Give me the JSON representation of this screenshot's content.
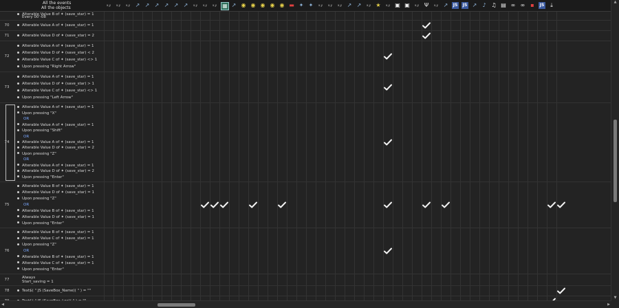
{
  "header": {
    "all_events": "All the events",
    "all_objects": "All the objects"
  },
  "columns": [
    {
      "kind": "tag",
      "glyph": "x,y"
    },
    {
      "kind": "tag",
      "glyph": "x,y"
    },
    {
      "kind": "tag",
      "glyph": "x,y"
    },
    {
      "kind": "plain",
      "glyph": "↗"
    },
    {
      "kind": "plain",
      "glyph": "↗"
    },
    {
      "kind": "plain",
      "glyph": "↗"
    },
    {
      "kind": "plain",
      "glyph": "↗"
    },
    {
      "kind": "plain",
      "glyph": "↗"
    },
    {
      "kind": "plain",
      "glyph": "↗"
    },
    {
      "kind": "tag",
      "glyph": "x,y"
    },
    {
      "kind": "tag",
      "glyph": "x,y"
    },
    {
      "kind": "tag",
      "glyph": "x,y"
    },
    {
      "kind": "box",
      "glyph": "▦"
    },
    {
      "kind": "plain",
      "glyph": "↗"
    },
    {
      "kind": "yellow",
      "glyph": "◉"
    },
    {
      "kind": "yellow",
      "glyph": "◉"
    },
    {
      "kind": "yellow",
      "glyph": "◉"
    },
    {
      "kind": "yellow",
      "glyph": "◉"
    },
    {
      "kind": "yellow",
      "glyph": "◉"
    },
    {
      "kind": "red",
      "glyph": "▬"
    },
    {
      "kind": "plain",
      "glyph": "✦"
    },
    {
      "kind": "plain",
      "glyph": "✦"
    },
    {
      "kind": "tag",
      "glyph": "x,y"
    },
    {
      "kind": "tag",
      "glyph": "x,y"
    },
    {
      "kind": "tag",
      "glyph": "x,y"
    },
    {
      "kind": "plain",
      "glyph": "↗"
    },
    {
      "kind": "plain",
      "glyph": "↗"
    },
    {
      "kind": "tag",
      "glyph": "x,y"
    },
    {
      "kind": "yellow",
      "glyph": "★"
    },
    {
      "kind": "tag",
      "glyph": "x,y"
    },
    {
      "kind": "white",
      "glyph": "▣"
    },
    {
      "kind": "white",
      "glyph": "▣"
    },
    {
      "kind": "tag",
      "glyph": "x,y"
    },
    {
      "kind": "white",
      "glyph": "Ψ"
    },
    {
      "kind": "tag",
      "glyph": "x,y"
    },
    {
      "kind": "plain",
      "glyph": "↗"
    },
    {
      "kind": "blue",
      "glyph": "JS"
    },
    {
      "kind": "blue",
      "glyph": "JS"
    },
    {
      "kind": "plain",
      "glyph": "↗"
    },
    {
      "kind": "plain",
      "glyph": "♪"
    },
    {
      "kind": "white",
      "glyph": "♫"
    },
    {
      "kind": "white",
      "glyph": "▤"
    },
    {
      "kind": "white",
      "glyph": "∞"
    },
    {
      "kind": "white",
      "glyph": "∞"
    },
    {
      "kind": "red",
      "glyph": "▪"
    },
    {
      "kind": "blue",
      "glyph": "JS"
    },
    {
      "kind": "white",
      "glyph": "⤓"
    }
  ],
  "rows": [
    {
      "num": "",
      "height": 12,
      "lines": [
        {
          "t": "Alterable Value B of ✦ (save_star) = 1",
          "bul": true
        },
        {
          "t": "Every 00'-08"
        }
      ],
      "checks": []
    },
    {
      "num": "70",
      "height": 14,
      "lines": [
        {
          "t": "Alterable Value A of ✦ (save_star) = 1",
          "bul": true
        }
      ],
      "checks": [
        33
      ]
    },
    {
      "num": "71",
      "height": 14,
      "lines": [
        {
          "t": "Alterable Value D of ✦ (save_star) = 2",
          "bul": true
        }
      ],
      "checks": [
        33
      ]
    },
    {
      "num": "72",
      "height": 44,
      "lines": [
        {
          "t": "Alterable Value A of ✦ (save_star) = 1",
          "bul": true
        },
        {
          "t": "Alterable Value D of ✦ (save_star) < 2",
          "bul": true
        },
        {
          "t": "Alterable Value C of ✦ (save_star) <> 1",
          "bul": true
        },
        {
          "t": "Upon pressing \"Right Arrow\"",
          "bul": true
        }
      ],
      "checks": [
        29
      ]
    },
    {
      "num": "73",
      "height": 44,
      "lines": [
        {
          "t": "Alterable Value A of ✦ (save_star) = 1",
          "bul": true
        },
        {
          "t": "Alterable Value D of ✦ (save_star) > 1",
          "bul": true
        },
        {
          "t": "Alterable Value C of ✦ (save_star) <> 1",
          "bul": true
        },
        {
          "t": "Upon pressing \"Left Arrow\"",
          "bul": true
        }
      ],
      "checks": [
        29
      ]
    },
    {
      "num": "74",
      "height": 114,
      "lines": [
        {
          "t": "Alterable Value A of ✦ (save_star) = 1",
          "bul": true
        },
        {
          "t": "Upon pressing \"X\"",
          "bul": true
        },
        {
          "t": "OR",
          "or": true
        },
        {
          "t": "Alterable Value A of ✦ (save_star) = 1",
          "bul": true
        },
        {
          "t": "Upon pressing \"Shift\"",
          "bul": true
        },
        {
          "t": "OR",
          "or": true
        },
        {
          "t": "Alterable Value A of ✦ (save_star) = 1",
          "bul": true
        },
        {
          "t": "Alterable Value D of ✦ (save_star) = 2",
          "bul": true
        },
        {
          "t": "Upon pressing \"Z\"",
          "bul": true
        },
        {
          "t": "OR",
          "or": true
        },
        {
          "t": "Alterable Value A of ✦ (save_star) = 1",
          "bul": true
        },
        {
          "t": "Alterable Value D of ✦ (save_star) = 2",
          "bul": true
        },
        {
          "t": "Upon pressing \"Enter\"",
          "bul": true
        }
      ],
      "checks": [
        29
      ]
    },
    {
      "num": "75",
      "height": 66,
      "lines": [
        {
          "t": "Alterable Value B of ✦ (save_star) = 1",
          "bul": true
        },
        {
          "t": "Alterable Value D of ✦ (save_star) = 1",
          "bul": true
        },
        {
          "t": "Upon pressing \"Z\"",
          "bul": true
        },
        {
          "t": "OR",
          "or": true
        },
        {
          "t": "Alterable Value B of ✦ (save_star) = 1",
          "bul": true
        },
        {
          "t": "Alterable Value D of ✦ (save_star) = 1",
          "bul": true
        },
        {
          "t": "Upon pressing \"Enter\"",
          "bul": true
        }
      ],
      "checks": [
        10,
        11,
        12,
        15,
        18,
        29,
        33,
        35,
        46,
        47
      ]
    },
    {
      "num": "76",
      "height": 66,
      "lines": [
        {
          "t": "Alterable Value B of ✦ (save_star) = 1",
          "bul": true
        },
        {
          "t": "Alterable Value C of ✦ (save_star) = 1",
          "bul": true
        },
        {
          "t": "Upon pressing \"Z\"",
          "bul": true
        },
        {
          "t": "OR",
          "or": true
        },
        {
          "t": "Alterable Value B of ✦ (save_star) = 1",
          "bul": true
        },
        {
          "t": "Alterable Value C of ✦ (save_star) = 1",
          "bul": true
        },
        {
          "t": "Upon pressing \"Enter\"",
          "bul": true
        }
      ],
      "checks": [
        29
      ]
    },
    {
      "num": "77",
      "height": 16,
      "lines": [
        {
          "t": "Always",
          "bul": false
        },
        {
          "t": "Start_saving = 1",
          "bul": false
        }
      ],
      "checks": []
    },
    {
      "num": "78",
      "height": 14,
      "lines": [
        {
          "t": "Text$( \" JS (SaveBox_Name)( \" ) = \"\"",
          "bul": true,
          "js": true
        }
      ],
      "checks": [
        47
      ]
    },
    {
      "num": "79",
      "height": 14,
      "lines": [
        {
          "t": "Text$( \" JS (SaveBox_Loc)( \" ) = \"\"",
          "bul": true,
          "js": true
        }
      ],
      "checks": [
        46
      ]
    }
  ],
  "selection": {
    "row_index": 5
  },
  "scroll": {
    "v_fraction": 0.55,
    "h_fraction": 0.27
  }
}
